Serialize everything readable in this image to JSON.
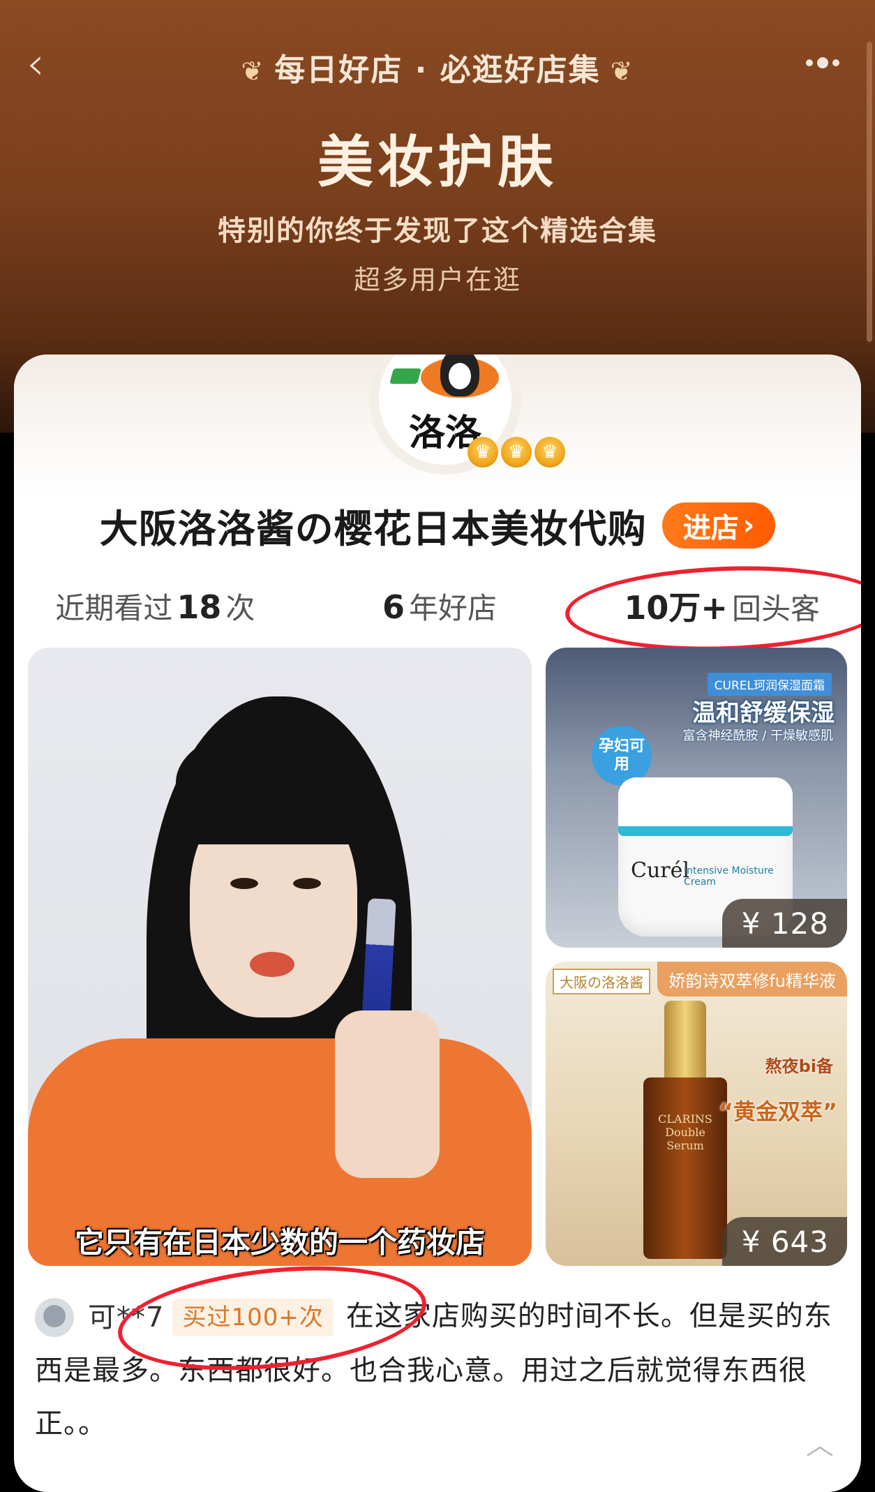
{
  "header": {
    "back_icon": "chevron-left-icon",
    "more_icon": "more-dots-icon",
    "brand_title": "每日好店 · 必逛好店集",
    "category_title": "美妆护肤",
    "subtitle": "特别的你终于发现了这个精选合集",
    "visitors_text": "超多用户在逛"
  },
  "shop": {
    "logo_text": "洛洛",
    "name": "大阪洛洛酱の樱花日本美妆代购",
    "enter_label": "进店",
    "enter_arrow": "›",
    "stats": [
      {
        "prefix": "近期看过",
        "value": "18",
        "suffix": "次"
      },
      {
        "prefix": "",
        "value": "6",
        "suffix": "年好店"
      },
      {
        "prefix": "",
        "value": "10万+",
        "suffix": "回头客"
      }
    ]
  },
  "media": {
    "video_caption": "它只有在日本少数的一个药妆店",
    "products": [
      {
        "tag": "CUREL珂润保湿面霜",
        "headline": "温和舒缓保湿",
        "subline": "富含神经酰胺 / 干燥敏感肌",
        "badge": "孕妇可用",
        "brand": "Curél",
        "jar_text": "Intensive Moisture Cream",
        "price": "¥ 128"
      },
      {
        "shop_label": "大阪の洛洛酱",
        "banner": "娇韵诗双萃修fu精华液",
        "bottle_brand": "CLARINS Double Serum",
        "note": "熬夜bi备",
        "gold": "“黄金双萃”",
        "price": "¥ 643"
      }
    ]
  },
  "review": {
    "reviewer": "可**7",
    "badge": "买过100+次",
    "text": "在这家店购买的时间不长。但是买的东西是最多。东西都很好。也合我心意。用过之后就觉得东西很正。。",
    "collapse_icon": "chevron-up-icon"
  },
  "colors": {
    "accent": "#ff5b00",
    "annotation": "#f02030",
    "hero_bg": "#7a3f1c"
  }
}
